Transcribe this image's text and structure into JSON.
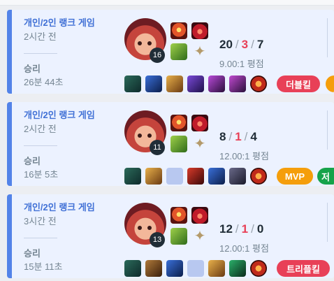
{
  "games": [
    {
      "queue": "개인/2인 랭크 게임",
      "time_ago": "2시간 전",
      "result": "승리",
      "duration": "26분 44초",
      "champion_level": "16",
      "kills": "20",
      "deaths": "3",
      "assists": "7",
      "kda_ratio": "9.00:1 평점",
      "badges": [
        {
          "label": "더블킬",
          "color": "#e84057"
        },
        {
          "label": "",
          "color": "#f59e0b"
        }
      ]
    },
    {
      "queue": "개인/2인 랭크 게임",
      "time_ago": "2시간 전",
      "result": "승리",
      "duration": "16분 5초",
      "champion_level": "11",
      "kills": "8",
      "deaths": "1",
      "assists": "4",
      "kda_ratio": "12.00:1 평점",
      "badges": [
        {
          "label": "MVP",
          "color": "#f59e0b"
        },
        {
          "label": "저",
          "color": "#16a34a"
        }
      ]
    },
    {
      "queue": "개인/2인 랭크 게임",
      "time_ago": "3시간 전",
      "result": "승리",
      "duration": "15분 11초",
      "champion_level": "13",
      "kills": "12",
      "deaths": "1",
      "assists": "0",
      "kda_ratio": "12.00:1 평점",
      "badges": [
        {
          "label": "트리플킬",
          "color": "#e84057"
        }
      ]
    }
  ],
  "icons": {
    "spell_1": "flash-icon",
    "spell_2": "ignite-icon",
    "rune_primary": "electrocute-rune-icon",
    "rune_secondary": "domination-tree-icon"
  }
}
